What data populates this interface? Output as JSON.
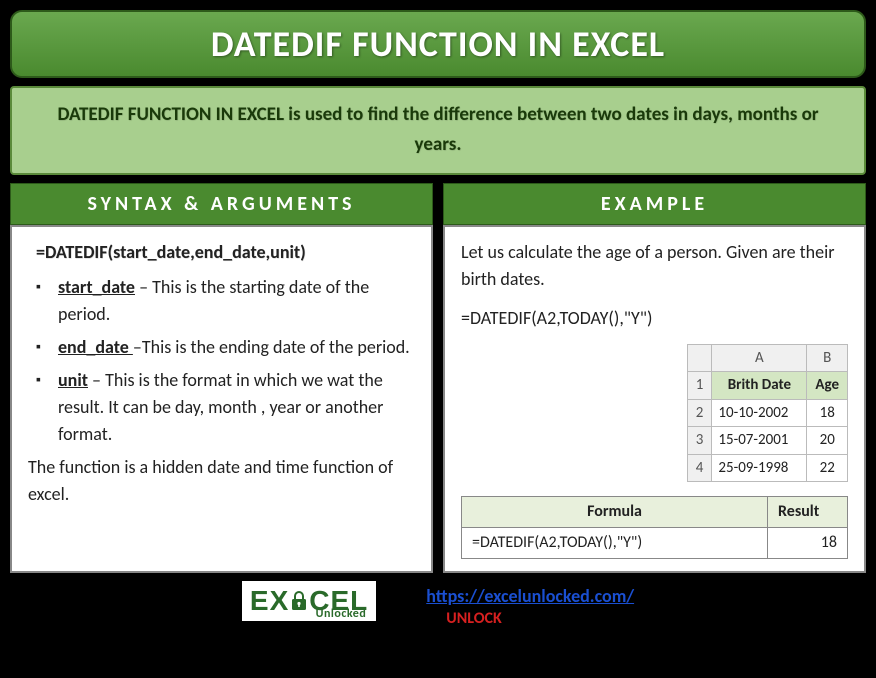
{
  "title": "DATEDIF FUNCTION IN EXCEL",
  "description_strong": "DATEDIF FUNCTION IN EXCEL",
  "description_rest": " is used to find the difference between two dates in days, months or years.",
  "left": {
    "header": "SYNTAX & ARGUMENTS",
    "syntax": "=DATEDIF(start_date,end_date,unit)",
    "args": [
      {
        "name": "start_date",
        "desc": " – This is the starting date of the period."
      },
      {
        "name": "end_date ",
        "desc": "–This is the ending date of the period."
      },
      {
        "name": "unit",
        "desc": " – This is the format in which we wat the result. It can be day, month , year or another format."
      }
    ],
    "note": "The function is a hidden date and time function of excel."
  },
  "right": {
    "header": "EXAMPLE",
    "intro": "Let us calculate the age of a person. Given are their birth dates.",
    "formula": "=DATEDIF(A2,TODAY(),\"Y\")",
    "sheet": {
      "cols": [
        "A",
        "B"
      ],
      "header_row": [
        "Brith Date",
        "Age"
      ],
      "rows": [
        {
          "n": "2",
          "a": "10-10-2002",
          "b": "18"
        },
        {
          "n": "3",
          "a": "15-07-2001",
          "b": "20"
        },
        {
          "n": "4",
          "a": "25-09-1998",
          "b": "22"
        }
      ]
    },
    "result": {
      "h1": "Formula",
      "h2": "Result",
      "formula": "=DATEDIF(A2,TODAY(),\"Y\")",
      "value": "18"
    }
  },
  "footer": {
    "logo_pre": "E",
    "logo_x": "X",
    "logo_c": "CEL",
    "logo_sub": "Unlocked",
    "link": "https://excelunlocked.com/",
    "unlock": "UNLOCK"
  }
}
